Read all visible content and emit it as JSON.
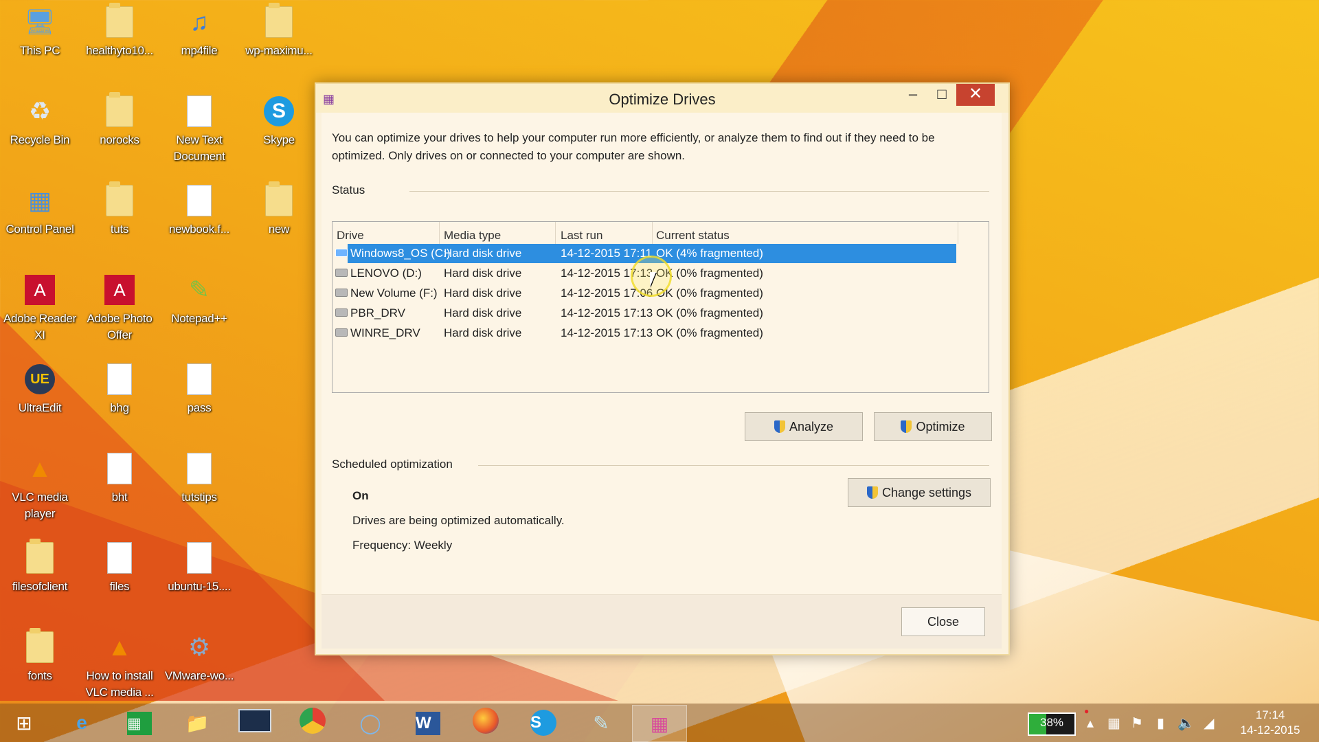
{
  "desktop": {
    "icons": [
      {
        "label": "This PC",
        "icon": "this-pc-icon"
      },
      {
        "label": "healthyto10...",
        "icon": "folder-icon"
      },
      {
        "label": "mp4file",
        "icon": "media-file-icon"
      },
      {
        "label": "wp-maximu...",
        "icon": "zip-folder-icon"
      },
      {
        "label": "Recycle Bin",
        "icon": "recycle-bin-icon"
      },
      {
        "label": "norocks",
        "icon": "folder-icon"
      },
      {
        "label": "New Text Document",
        "icon": "text-document-icon"
      },
      {
        "label": "Skype",
        "icon": "skype-icon"
      },
      {
        "label": "Control Panel",
        "icon": "control-panel-icon"
      },
      {
        "label": "tuts",
        "icon": "folder-icon"
      },
      {
        "label": "newbook.f...",
        "icon": "file-icon"
      },
      {
        "label": "new",
        "icon": "folder-icon"
      },
      {
        "label": "Adobe Reader XI",
        "icon": "adobe-reader-icon"
      },
      {
        "label": "Adobe Photo Offer",
        "icon": "adobe-photo-icon"
      },
      {
        "label": "Notepad++",
        "icon": "notepad-plus-icon"
      },
      {
        "label": "UltraEdit",
        "icon": "ultraedit-icon"
      },
      {
        "label": "bhg",
        "icon": "file-icon"
      },
      {
        "label": "pass",
        "icon": "file-icon"
      },
      {
        "label": "VLC media player",
        "icon": "vlc-icon"
      },
      {
        "label": "bht",
        "icon": "file-icon"
      },
      {
        "label": "tutstips",
        "icon": "file-icon"
      },
      {
        "label": "filesofclient",
        "icon": "folder-icon"
      },
      {
        "label": "files",
        "icon": "file-icon"
      },
      {
        "label": "ubuntu-15....",
        "icon": "torrent-file-icon"
      },
      {
        "label": "fonts",
        "icon": "folder-icon"
      },
      {
        "label": "How to install VLC media ...",
        "icon": "vlc-icon"
      },
      {
        "label": "VMware-wo...",
        "icon": "vmware-installer-icon"
      }
    ]
  },
  "window": {
    "title": "Optimize Drives",
    "intro": "You can optimize your drives to help your computer run more efficiently, or analyze them to find out if they need to be optimized. Only drives on or connected to your computer are shown.",
    "status_heading": "Status",
    "columns": [
      "Drive",
      "Media type",
      "Last run",
      "Current status"
    ],
    "drives": [
      {
        "name": "Windows8_OS (C:)",
        "media": "Hard disk drive",
        "last_run": "14-12-2015 17:11",
        "status": "OK (4% fragmented)"
      },
      {
        "name": "LENOVO (D:)",
        "media": "Hard disk drive",
        "last_run": "14-12-2015 17:13",
        "status": "OK (0% fragmented)"
      },
      {
        "name": "New Volume (F:)",
        "media": "Hard disk drive",
        "last_run": "14-12-2015 17:06",
        "status": "OK (0% fragmented)"
      },
      {
        "name": "PBR_DRV",
        "media": "Hard disk drive",
        "last_run": "14-12-2015 17:13",
        "status": "OK (0% fragmented)"
      },
      {
        "name": "WINRE_DRV",
        "media": "Hard disk drive",
        "last_run": "14-12-2015 17:13",
        "status": "OK (0% fragmented)"
      }
    ],
    "analyze_label": "Analyze",
    "optimize_label": "Optimize",
    "scheduled_heading": "Scheduled optimization",
    "schedule_state": "On",
    "change_settings_label": "Change settings",
    "schedule_desc": "Drives are being optimized automatically.",
    "frequency": "Frequency: Weekly",
    "close_label": "Close"
  },
  "taskbar": {
    "apps": [
      "start-icon",
      "internet-explorer-icon",
      "store-icon",
      "file-explorer-icon",
      "lenovo-icon",
      "chrome-icon",
      "search-app-icon",
      "word-icon",
      "firefox-icon",
      "skype-icon",
      "notepad-icon",
      "defrag-icon"
    ],
    "battery": "38%",
    "time": "17:14",
    "date": "14-12-2015"
  },
  "colors": {
    "selection": "#2d8ee0",
    "close_button": "#c7432f",
    "window_bg": "#fdf5e6"
  }
}
